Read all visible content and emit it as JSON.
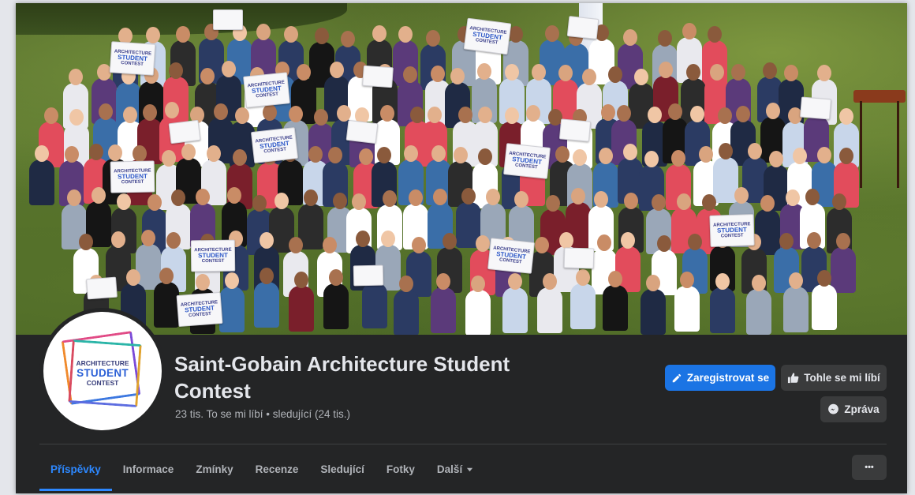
{
  "cover": {
    "sign_line1": "ARCHITECTURE",
    "sign_line2": "STUDENT",
    "sign_line3": "CONTEST"
  },
  "profile": {
    "logo_line1": "ARCHITECTURE",
    "logo_line2": "STUDENT",
    "logo_line3": "CONTEST",
    "title": "Saint-Gobain Architecture Student Contest",
    "meta": "23 tis. To se mi líbí • sledující (24 tis.)"
  },
  "actions": {
    "register_label": "Zaregistrovat se",
    "like_label": "Tohle se mi líbí",
    "message_label": "Zpráva",
    "more_label": "•••"
  },
  "tabs": [
    {
      "label": "Příspěvky",
      "active": true
    },
    {
      "label": "Informace"
    },
    {
      "label": "Zmínky"
    },
    {
      "label": "Recenze"
    },
    {
      "label": "Sledující"
    },
    {
      "label": "Fotky"
    },
    {
      "label": "Další"
    }
  ],
  "colors": {
    "accent": "#1b74e4",
    "tab_active": "#2d88ff",
    "background": "#242526"
  }
}
